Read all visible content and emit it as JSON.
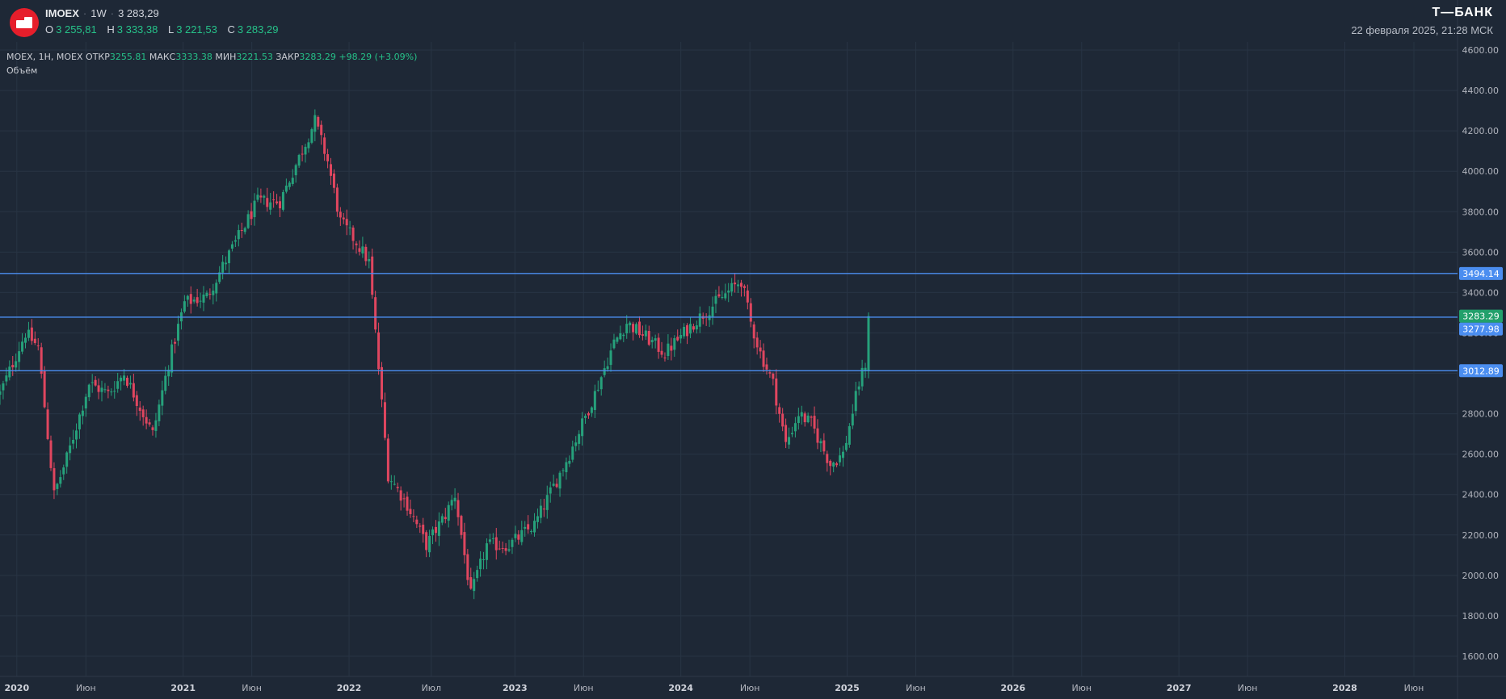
{
  "header": {
    "symbol": "IMOEX",
    "interval": "1W",
    "last_price": "3 283,29",
    "ohlc": [
      {
        "key": "O",
        "value": "3 255,81"
      },
      {
        "key": "H",
        "value": "3 333,38"
      },
      {
        "key": "L",
        "value": "3 221,53"
      },
      {
        "key": "C",
        "value": "3 283,29"
      }
    ],
    "brand": "Т—БАНК",
    "datetime": "22 февраля 2025, 21:28 МСК"
  },
  "series_legend": {
    "name": "MOEX, 1H, MOEX",
    "open_label": "ОТКР",
    "open": "3255.81",
    "high_label": "МАКС",
    "high": "3333.38",
    "low_label": "МИН",
    "low": "3221.53",
    "close_label": "ЗАКР",
    "close": "3283.29",
    "change": "+98.29 (+3.09%)",
    "volume_label": "Объём"
  },
  "colors": {
    "background": "#1e2836",
    "up": "#26a17b",
    "down": "#e0465f",
    "hline": "#4b8ef0",
    "last_price_badge": "#22a06b",
    "axis_text": "#b2b5be"
  },
  "chart_data": {
    "type": "candlestick",
    "price_axis": {
      "range": [
        1500,
        4640
      ],
      "ticks": [
        "1600.00",
        "1800.00",
        "2000.00",
        "2200.00",
        "2400.00",
        "2600.00",
        "2800.00",
        "3000.00",
        "3200.00",
        "3400.00",
        "3600.00",
        "3800.00",
        "4000.00",
        "4200.00",
        "4400.00",
        "4600.00"
      ]
    },
    "time_axis": {
      "range": [
        "2019-11-25",
        "2028-09-05"
      ],
      "ticks": [
        {
          "date": "2020-01-01",
          "label": "2020",
          "bold": true
        },
        {
          "date": "2020-06-01",
          "label": "Июн",
          "bold": false
        },
        {
          "date": "2021-01-01",
          "label": "2021",
          "bold": true
        },
        {
          "date": "2021-06-01",
          "label": "Июн",
          "bold": false
        },
        {
          "date": "2022-01-01",
          "label": "2022",
          "bold": true
        },
        {
          "date": "2022-07-01",
          "label": "Июл",
          "bold": false
        },
        {
          "date": "2023-01-01",
          "label": "2023",
          "bold": true
        },
        {
          "date": "2023-06-01",
          "label": "Июн",
          "bold": false
        },
        {
          "date": "2024-01-01",
          "label": "2024",
          "bold": true
        },
        {
          "date": "2024-06-01",
          "label": "Июн",
          "bold": false
        },
        {
          "date": "2025-01-01",
          "label": "2025",
          "bold": true
        },
        {
          "date": "2025-06-01",
          "label": "Июн",
          "bold": false
        },
        {
          "date": "2026-01-01",
          "label": "2026",
          "bold": true
        },
        {
          "date": "2026-06-01",
          "label": "Июн",
          "bold": false
        },
        {
          "date": "2027-01-01",
          "label": "2027",
          "bold": true
        },
        {
          "date": "2027-06-01",
          "label": "Июн",
          "bold": false
        },
        {
          "date": "2028-01-01",
          "label": "2028",
          "bold": true
        },
        {
          "date": "2028-06-01",
          "label": "Июн",
          "bold": false
        }
      ]
    },
    "horizontal_lines": [
      {
        "price": 3494.14,
        "label": "3494.14"
      },
      {
        "price": 3277.98,
        "label": "3277.98"
      },
      {
        "price": 3012.89,
        "label": "3012.89"
      }
    ],
    "last_price": {
      "price": 3283.29,
      "label": "3283.29"
    },
    "weekly_close_path": [
      [
        "2019-11-25",
        2900
      ],
      [
        "2020-01-20",
        3200
      ],
      [
        "2020-02-17",
        3130
      ],
      [
        "2020-03-23",
        2400
      ],
      [
        "2020-04-20",
        2580
      ],
      [
        "2020-06-08",
        2950
      ],
      [
        "2020-07-20",
        2900
      ],
      [
        "2020-08-24",
        3000
      ],
      [
        "2020-10-26",
        2700
      ],
      [
        "2020-11-30",
        3050
      ],
      [
        "2021-01-04",
        3350
      ],
      [
        "2021-02-22",
        3380
      ],
      [
        "2021-04-05",
        3560
      ],
      [
        "2021-06-14",
        3850
      ],
      [
        "2021-08-02",
        3850
      ],
      [
        "2021-10-18",
        4250
      ],
      [
        "2021-11-15",
        4050
      ],
      [
        "2021-12-13",
        3750
      ],
      [
        "2022-01-17",
        3650
      ],
      [
        "2022-02-14",
        3550
      ],
      [
        "2022-03-28",
        2500
      ],
      [
        "2022-05-09",
        2350
      ],
      [
        "2022-06-20",
        2150
      ],
      [
        "2022-08-01",
        2300
      ],
      [
        "2022-08-22",
        2400
      ],
      [
        "2022-09-26",
        1900
      ],
      [
        "2022-10-31",
        2150
      ],
      [
        "2022-12-19",
        2150
      ],
      [
        "2023-02-13",
        2250
      ],
      [
        "2023-05-01",
        2600
      ],
      [
        "2023-06-26",
        2900
      ],
      [
        "2023-08-07",
        3150
      ],
      [
        "2023-09-04",
        3250
      ],
      [
        "2023-10-16",
        3180
      ],
      [
        "2023-11-27",
        3100
      ],
      [
        "2024-01-29",
        3250
      ],
      [
        "2024-03-18",
        3350
      ],
      [
        "2024-05-13",
        3460
      ],
      [
        "2024-06-03",
        3250
      ],
      [
        "2024-06-24",
        3100
      ],
      [
        "2024-07-22",
        2950
      ],
      [
        "2024-08-19",
        2650
      ],
      [
        "2024-09-16",
        2800
      ],
      [
        "2024-10-14",
        2750
      ],
      [
        "2024-11-25",
        2550
      ],
      [
        "2024-12-23",
        2600
      ],
      [
        "2025-01-27",
        2950
      ],
      [
        "2025-02-10",
        3050
      ],
      [
        "2025-02-17",
        3283.29
      ]
    ]
  }
}
